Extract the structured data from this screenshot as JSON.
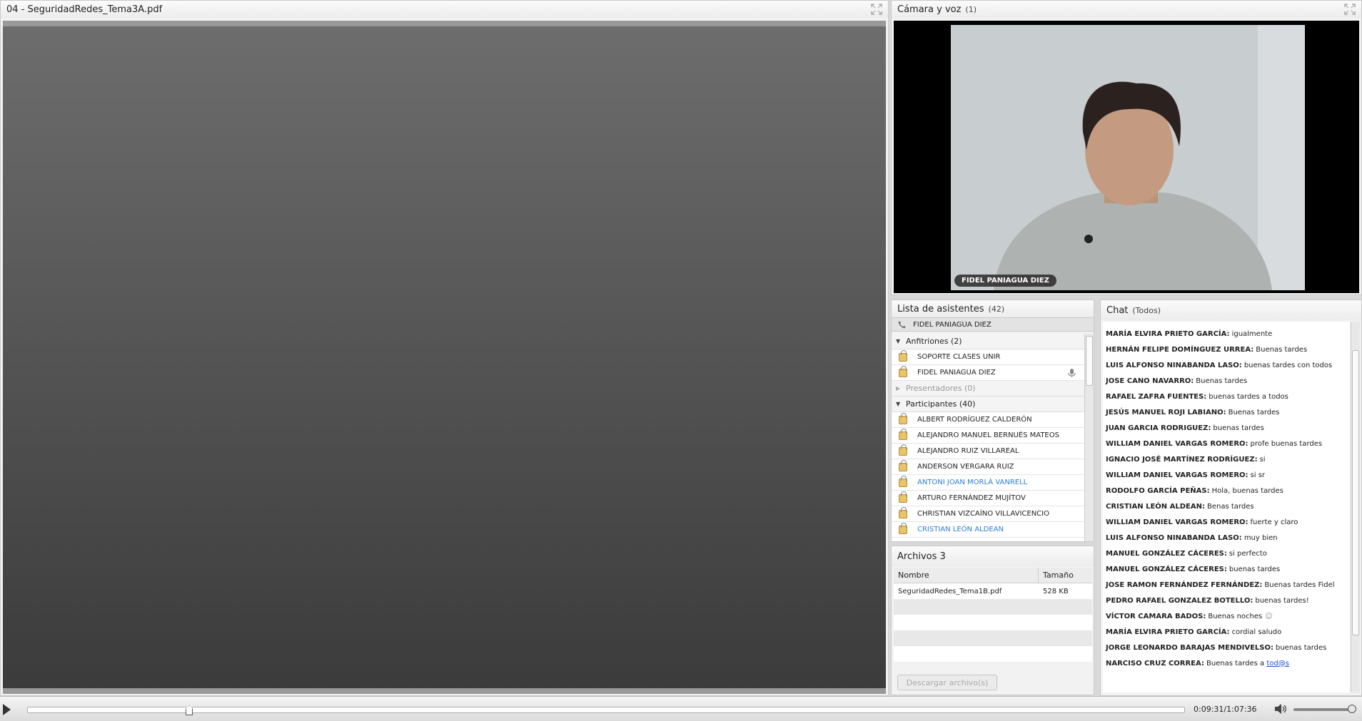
{
  "share_pod": {
    "title": "04 - SeguridadRedes_Tema3A.pdf"
  },
  "camera_pod": {
    "title": "Cámara y voz",
    "count": "(1)",
    "video_name": "FIDEL  PANIAGUA DIEZ"
  },
  "attendees_pod": {
    "title": "Lista de asistentes",
    "count": "(42)",
    "speaking_user": "FIDEL  PANIAGUA DIEZ",
    "groups": {
      "hosts": {
        "label": "Anfitriones (2)",
        "members": [
          "SOPORTE CLASES UNIR",
          "FIDEL  PANIAGUA DIEZ"
        ]
      },
      "presenters": {
        "label": "Presentadores (0)"
      },
      "participants": {
        "label": "Participantes (40)",
        "members": [
          "ALBERT RODRÍGUEZ CALDERÓN",
          "ALEJANDRO MANUEL BERNUÉS MATEOS",
          "ALEJANDRO RUIZ VILLAREAL",
          "ANDERSON VERGARA RUIZ",
          "ANTONI JOAN MORLÀ VANRELL",
          "ARTURO FERNÁNDEZ MUJÍTOV",
          "CHRISTIAN VIZCAÍNO VILLAVICENCIO",
          "CRISTIAN LEÓN ALDEAN"
        ]
      }
    }
  },
  "files_pod": {
    "title": "Archivos 3",
    "columns": [
      "Nombre",
      "Tamaño"
    ],
    "rows": [
      {
        "name": "SeguridadRedes_Tema1B.pdf",
        "size": "528 KB"
      }
    ],
    "download_label": "Descargar archivo(s)"
  },
  "chat_pod": {
    "title": "Chat",
    "scope": "(Todos)",
    "messages": [
      {
        "author": "MARÍA ELVIRA PRIETO GARCÍA:",
        "text": "igualmente"
      },
      {
        "author": "HERNÁN FELIPE DOMÍNGUEZ URREA:",
        "text": "Buenas tardes"
      },
      {
        "author": "LUIS ALFONSO NINABANDA LASO:",
        "text": "buenas tardes con todos"
      },
      {
        "author": "JOSE CANO NAVARRO:",
        "text": "Buenas tardes"
      },
      {
        "author": "RAFAEL ZAFRA FUENTES:",
        "text": "buenas tardes a todos"
      },
      {
        "author": "JESÚS MANUEL ROJI LABIANO:",
        "text": "Buenas tardes"
      },
      {
        "author": "JUAN GARCIA RODRIGUEZ:",
        "text": "buenas tardes"
      },
      {
        "author": "WILLIAM DANIEL VARGAS ROMERO:",
        "text": "profe buenas tardes"
      },
      {
        "author": "IGNACIO JOSÉ MARTÍNEZ RODRÍGUEZ:",
        "text": "si"
      },
      {
        "author": "WILLIAM DANIEL VARGAS ROMERO:",
        "text": "si sr"
      },
      {
        "author": "RODOLFO GARCÍA PEÑAS:",
        "text": "Hola, buenas tardes"
      },
      {
        "author": "CRISTIAN LEÓN ALDEAN:",
        "text": "Benas tardes"
      },
      {
        "author": "WILLIAM DANIEL VARGAS ROMERO:",
        "text": "fuerte y claro"
      },
      {
        "author": "LUIS ALFONSO NINABANDA LASO:",
        "text": "muy  bien"
      },
      {
        "author": "MANUEL GONZÁLEZ CÁCERES:",
        "text": "si perfecto"
      },
      {
        "author": "MANUEL GONZÁLEZ CÁCERES:",
        "text": "buenas tardes"
      },
      {
        "author": "JOSE RAMON FERNÁNDEZ FERNÁNDEZ:",
        "text": "Buenas tardes Fidel"
      },
      {
        "author": "PEDRO RAFAEL GONZALEZ BOTELLO:",
        "text": "buenas tardes!"
      },
      {
        "author": "VÍCTOR CAMARA BADOS:",
        "text": "Buenas noches"
      },
      {
        "author": "MARÍA ELVIRA PRIETO GARCÍA:",
        "text": "cordial saludo"
      },
      {
        "author": "JORGE LEONARDO BARAJAS MENDIVELSO:",
        "text": "buenas tardes"
      },
      {
        "author": "NARCISO CRUZ CORREA:",
        "text": "Buenas tardes a",
        "link": "tod@s"
      }
    ]
  },
  "playback": {
    "time": "0:09:31/1:07:36",
    "progress_fraction": 0.14,
    "volume_fraction": 0.95
  },
  "colors": {
    "link_blue": "#2a7fd4",
    "lock_gold": "#e8c56a",
    "share_gray": "#4a4a4a"
  }
}
